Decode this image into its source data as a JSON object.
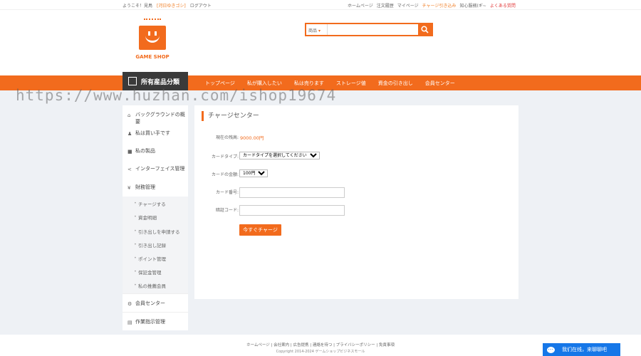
{
  "topbar": {
    "welcome": "ようこそ！見鳥",
    "member_tag": "[河日ゆきゴシ]",
    "logout": "ログアウト",
    "links": [
      "ホームページ",
      "注文履歴",
      "マイページ",
      "チャージ引き込み",
      "知心服務(ギ~",
      "よくある質問"
    ]
  },
  "logo": {
    "text": "GAME SHOP"
  },
  "search": {
    "category": "商品",
    "placeholder": ""
  },
  "nav": {
    "category_label": "所有産品分類",
    "items": [
      "トップページ",
      "私が購入したい",
      "私は売ります",
      "ストレージ値",
      "資金の引き出し",
      "会員センター"
    ]
  },
  "watermark": "https://www.huzhan.com/ishop19674",
  "sidebar": {
    "items": [
      {
        "label": "バックグラウンドの概要",
        "icon": "home-icon"
      },
      {
        "label": "私は買い手です",
        "icon": "user-icon"
      },
      {
        "label": "私の製品",
        "icon": "box-icon"
      },
      {
        "label": "インターフェイス管理",
        "icon": "share-icon"
      },
      {
        "label": "財務管理",
        "icon": "yen-icon"
      }
    ],
    "sub_items": [
      "チャージする",
      "資金明細",
      "引き出しを申請する",
      "引き出し記録",
      "ポイント管理",
      "保証金管理",
      "私の推薦会員"
    ],
    "sections": [
      {
        "label": "会員センター",
        "icon": "gear-icon"
      },
      {
        "label": "作業指示管理",
        "icon": "doc-icon"
      }
    ]
  },
  "panel": {
    "title": "チャージセンター",
    "balance_label": "現在の残高:",
    "balance_value": "9000.00円",
    "card_type_label": "カードタイプ:",
    "card_type_value": "カードタイプを選択してください",
    "amount_label": "カードの金額:",
    "amount_value": "100円",
    "card_number_label": "カード番号:",
    "password_label": "暗証コード:",
    "submit_label": "今すぐチャージ"
  },
  "footer": {
    "links": "ホームページ | 会社案内 | 広告提携 | 連絡を待つ | プライバシーポリシー | 免責事項",
    "copyright": "Copyright 2014-2024 ゲームショップビジネスモール"
  },
  "chat": {
    "label": "我们在线，来聊聊吧"
  }
}
